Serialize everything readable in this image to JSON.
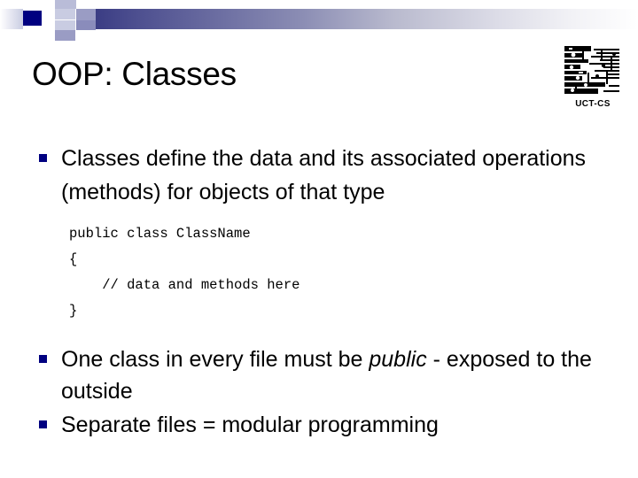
{
  "slide": {
    "title": "OOP: Classes",
    "logo": {
      "caption": "UCT-CS",
      "icon": "circuit-board-logo"
    },
    "decor": {
      "bar_color_start": "#3b3d84",
      "bar_color_end": "#ffffff",
      "square_dark": "#000080",
      "square_mid": "#9a9cc4",
      "square_light": "#c9cce2",
      "bullet_color": "#000080"
    },
    "content": {
      "bullets_top": [
        {
          "text": "Classes define the data and its associated operations (methods) for objects of that type"
        }
      ],
      "code": {
        "line1": "public class ClassName",
        "line2": "{",
        "line3": "    // data and methods here",
        "line4": "}"
      },
      "bullets_bottom": [
        {
          "prefix": "One class in every file must be ",
          "emphasis": "public",
          "suffix": " - exposed to the outside"
        },
        {
          "prefix": "Separate files = modular programming",
          "emphasis": "",
          "suffix": ""
        }
      ]
    }
  }
}
